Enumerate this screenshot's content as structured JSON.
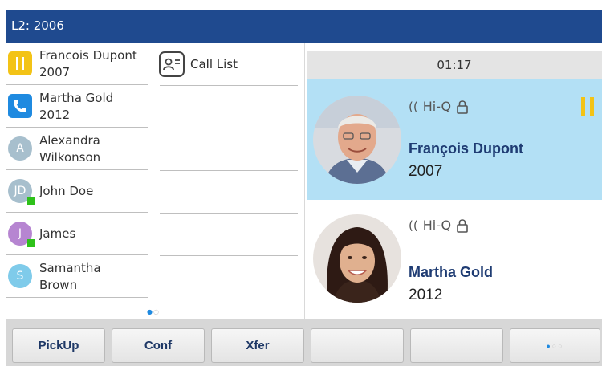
{
  "header": {
    "line_label": "L2: 2006"
  },
  "contacts": [
    {
      "line1": "Francois Dupont",
      "line2": "2007",
      "avatar": "pause-icon",
      "avatar_text": "",
      "avatar_color": "#f3c316",
      "presence": false
    },
    {
      "line1": "Martha Gold",
      "line2": "2012",
      "avatar": "phone-icon",
      "avatar_text": "",
      "avatar_color": "#1f8ae0",
      "presence": false
    },
    {
      "line1": "Alexandra",
      "line2": "Wilkonson",
      "avatar": "initial",
      "avatar_text": "A",
      "avatar_color": "#a7bfcd",
      "presence": false
    },
    {
      "line1": "John Doe",
      "line2": "",
      "avatar": "initial",
      "avatar_text": "JD",
      "avatar_color": "#a7bfcd",
      "presence": true
    },
    {
      "line1": "James",
      "line2": "",
      "avatar": "initial",
      "avatar_text": "J",
      "avatar_color": "#b685d1",
      "presence": true
    },
    {
      "line1": "Samantha",
      "line2": "Brown",
      "avatar": "initial",
      "avatar_text": "S",
      "avatar_color": "#7fcbea",
      "presence": false
    }
  ],
  "call_list": {
    "label": "Call List",
    "icon": "contact-card-icon"
  },
  "calls": {
    "timer": "01:17",
    "active": {
      "hiq": "Hi-Q",
      "name": "François Dupont",
      "number": "2007",
      "status": "hold"
    },
    "second": {
      "hiq": "Hi-Q",
      "name": "Martha Gold",
      "number": "2012"
    }
  },
  "softkeys": [
    "PickUp",
    "Conf",
    "Xfer",
    "",
    "",
    ""
  ],
  "colors": {
    "header": "#1f4a8f",
    "active_call": "#b3e0f5",
    "hold": "#f3c316",
    "name_text": "#1f3c73"
  }
}
